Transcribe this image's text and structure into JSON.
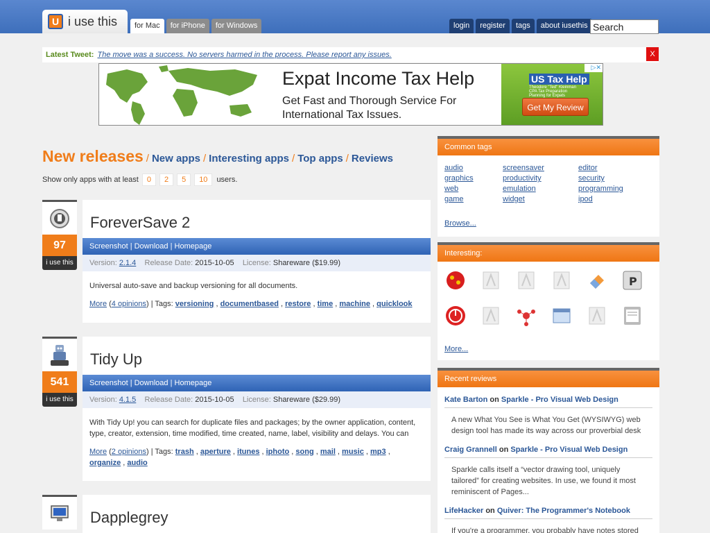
{
  "header": {
    "logo_text": "i use this",
    "logo_letter": "U",
    "platform_tabs": [
      "for Mac",
      "for iPhone",
      "for Windows"
    ],
    "user_nav": [
      "login",
      "register",
      "tags",
      "about iusethis"
    ],
    "search_placeholder": "Search"
  },
  "tweet": {
    "label": "Latest Tweet:",
    "text": "The move was a success. No servers harmed in the process. Please report any issues.",
    "close": "X"
  },
  "ad": {
    "headline": "Expat Income Tax Help",
    "body": "Get Fast and Thorough Service For International Tax Issues.",
    "brand": "US Tax Help",
    "brand_sub": "Theodore \"Ted\" Kleinman CPA Tax Preparation Planning for Expats",
    "cta": "Get My Review"
  },
  "main": {
    "heading_current": "New releases",
    "heading_links": [
      "New apps",
      "Interesting apps",
      "Top apps",
      "Reviews"
    ],
    "filter_prefix": "Show only apps with at least",
    "filter_options": [
      "0",
      "2",
      "5",
      "10"
    ],
    "filter_suffix": "users.",
    "apps": [
      {
        "name": "ForeverSave 2",
        "score": "97",
        "iuse_label": "i use this",
        "links": "Screenshot | Download | Homepage",
        "version_label": "Version:",
        "version": "2.1.4",
        "release_label": "Release Date:",
        "release_date": "2015-10-05",
        "license_label": "License:",
        "license": "Shareware ($19.99)",
        "description": "Universal auto-save and backup versioning for all documents.",
        "more": "More",
        "opinions": "4 opinions",
        "tags_label": "| Tags:",
        "tags": [
          "versioning",
          "documentbased",
          "restore",
          "time",
          "machine",
          "quicklook"
        ]
      },
      {
        "name": "Tidy Up",
        "score": "541",
        "iuse_label": "i use this",
        "links": "Screenshot | Download | Homepage",
        "version_label": "Version:",
        "version": "4.1.5",
        "release_label": "Release Date:",
        "release_date": "2015-10-05",
        "license_label": "License:",
        "license": "Shareware ($29.99)",
        "description": "With Tidy Up! you can search for duplicate files and packages; by the owner application, content, type, creator, extension, time modified, time created, name, label, visibility and delays. You can",
        "more": "More",
        "opinions": "2 opinions",
        "tags_label": "| Tags:",
        "tags": [
          "trash",
          "aperture",
          "itunes",
          "iphoto",
          "song",
          "mail",
          "music",
          "mp3",
          "organize",
          "audio"
        ]
      },
      {
        "name": "Dapplegrey"
      }
    ]
  },
  "sidebar": {
    "common_tags_title": "Common tags",
    "tags_col1": [
      "audio",
      "graphics",
      "web",
      "game"
    ],
    "tags_col2": [
      "screensaver",
      "productivity",
      "emulation",
      "widget"
    ],
    "tags_col3": [
      "editor",
      "security",
      "programming",
      "ipod"
    ],
    "browse": "Browse...",
    "interesting_title": "Interesting:",
    "interesting_more": "More...",
    "recent_reviews_title": "Recent reviews",
    "reviews": [
      {
        "author": "Kate Barton",
        "on": "on",
        "app": "Sparkle - Pro Visual Web Design",
        "text": "A new What You See is What You Get (WYSIWYG) web design tool has made its way across our proverbial desk"
      },
      {
        "author": "Craig Grannell",
        "on": "on",
        "app": "Sparkle - Pro Visual Web Design",
        "text": "Sparkle calls itself a “vector drawing tool, uniquely tailored” for creating websites. In use, we found it most reminiscent of Pages..."
      },
      {
        "author": "LifeHacker",
        "on": "on",
        "app": "Quiver: The Programmer's Notebook",
        "text": "If you're a programmer, you probably have notes stored"
      }
    ]
  },
  "colors": {
    "accent_orange": "#f07d1a",
    "header_blue": "#4a7bc6",
    "link_blue": "#2b5797"
  }
}
